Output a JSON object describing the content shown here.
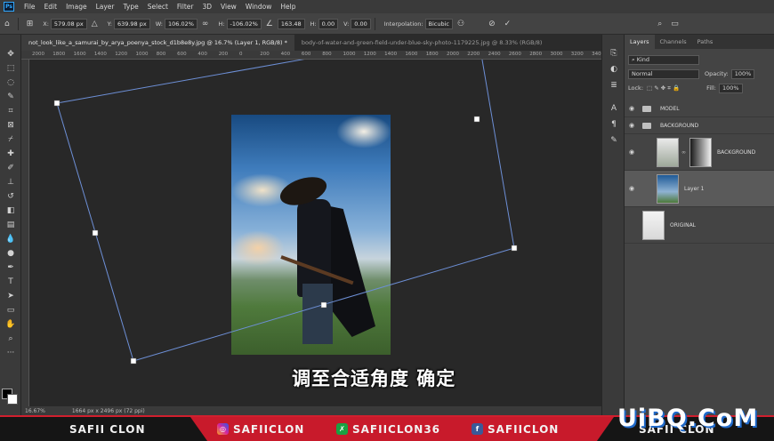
{
  "menu": {
    "logo": "Ps",
    "items": [
      "File",
      "Edit",
      "Image",
      "Layer",
      "Type",
      "Select",
      "Filter",
      "3D",
      "View",
      "Window",
      "Help"
    ]
  },
  "options": {
    "x_label": "X:",
    "x_value": "579.08 px",
    "y_label": "Y:",
    "y_value": "639.98 px",
    "w_label": "W:",
    "w_value": "106.02%",
    "h_label": "H:",
    "h_value": "-106.02%",
    "angle_value": "163.48",
    "hskew_label": "H:",
    "hskew_value": "0.00",
    "vskew_label": "V:",
    "vskew_value": "0.00",
    "interpolation_label": "Interpolation:",
    "interpolation_value": "Bicubic"
  },
  "tabs": [
    {
      "label": "not_look_like_a_samurai_by_arya_poenya_stock_d1b8e8y.jpg @ 16.7% (Layer 1, RGB/8) *"
    },
    {
      "label": "body-of-water-and-green-field-under-blue-sky-photo-1179225.jpg @ 8.33% (RGB/8)"
    }
  ],
  "ruler": {
    "labels": [
      "2000",
      "1800",
      "1600",
      "1400",
      "1200",
      "1000",
      "800",
      "600",
      "400",
      "200",
      "0",
      "200",
      "400",
      "600",
      "800",
      "1000",
      "1200",
      "1400",
      "1600",
      "1800",
      "2000",
      "2200",
      "2400",
      "2600",
      "2800",
      "3000",
      "3200",
      "3400"
    ]
  },
  "canvas": {
    "subtitle": "调至合适角度 确定"
  },
  "layers_panel": {
    "tabs": [
      "Layers",
      "Channels",
      "Paths"
    ],
    "kind_label": "Kind",
    "blend_mode": "Normal",
    "opacity_label": "Opacity:",
    "opacity_value": "100%",
    "lock_label": "Lock:",
    "fill_label": "Fill:",
    "fill_value": "100%",
    "layers": [
      {
        "name": "MODEL"
      },
      {
        "name": "BACKGROUND"
      },
      {
        "name": "BACKGROUND"
      },
      {
        "name": "Layer 1"
      },
      {
        "name": "ORIGINAL"
      }
    ]
  },
  "status": {
    "zoom": "16.67%",
    "doc_size": "1664 px x 2496 px (72 ppi)"
  },
  "banner": {
    "left_name": "SAFII CLON",
    "instagram": "SAFIICLON",
    "twitter": "SAFIICLON36",
    "facebook": "SAFIICLON",
    "right_name": "SAFII CLON"
  },
  "watermark": "UiBQ.CoM",
  "colors": {
    "banner_red": "#c81a2b",
    "transform_line": "#6d8fd6",
    "accent_blue": "#31a8ff"
  }
}
